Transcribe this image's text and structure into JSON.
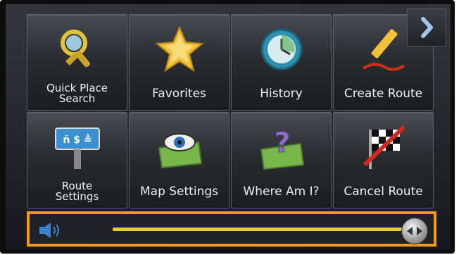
{
  "menu": {
    "tiles": [
      {
        "label": "Quick Place\nSearch",
        "icon": "magnifier-icon"
      },
      {
        "label": "Favorites",
        "icon": "star-icon"
      },
      {
        "label": "History",
        "icon": "clock-icon"
      },
      {
        "label": "Create Route",
        "icon": "pencil-icon"
      },
      {
        "label": "Route\nSettings",
        "icon": "road-sign-icon"
      },
      {
        "label": "Map Settings",
        "icon": "eye-map-icon"
      },
      {
        "label": "Where Am I?",
        "icon": "question-map-icon"
      },
      {
        "label": "Cancel Route",
        "icon": "crossed-flag-icon"
      }
    ]
  },
  "volume": {
    "level": 1.0,
    "accent_color": "#f39a1e",
    "track_color": "#e2cc4a"
  },
  "next_button": {
    "icon": "chevron-right-icon"
  }
}
